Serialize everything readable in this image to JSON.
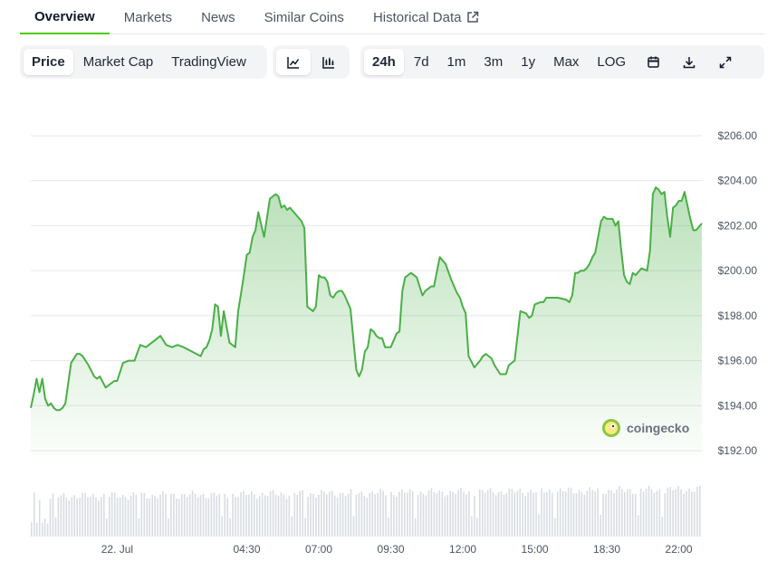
{
  "tabs": [
    {
      "label": "Overview",
      "active": true
    },
    {
      "label": "Markets"
    },
    {
      "label": "News"
    },
    {
      "label": "Similar Coins"
    },
    {
      "label": "Historical Data",
      "external": true
    }
  ],
  "toolbar": {
    "view_buttons": [
      {
        "label": "Price",
        "active": true
      },
      {
        "label": "Market Cap"
      },
      {
        "label": "TradingView"
      }
    ],
    "chart_type_icons": [
      "line-chart-icon",
      "candlestick-chart-icon"
    ],
    "range_buttons": [
      {
        "label": "24h",
        "active": true
      },
      {
        "label": "7d"
      },
      {
        "label": "1m"
      },
      {
        "label": "3m"
      },
      {
        "label": "1y"
      },
      {
        "label": "Max"
      },
      {
        "label": "LOG"
      }
    ],
    "action_icons": [
      "calendar-icon",
      "download-icon",
      "fullscreen-icon"
    ]
  },
  "watermark": {
    "text": "coingecko"
  },
  "colors": {
    "line": "#4aaf47",
    "accent": "#4bcc00",
    "volume": "#d8dce1",
    "grid": "#e5e7eb"
  },
  "chart_data": {
    "type": "area",
    "x_tick_labels": [
      "22. Jul",
      "04:30",
      "07:00",
      "09:30",
      "12:00",
      "15:00",
      "18:30",
      "22:00"
    ],
    "x_tick_hours": [
      0,
      4.5,
      7,
      9.5,
      12,
      14.5,
      17,
      19.5
    ],
    "y_tick_labels": [
      "$206.00",
      "$204.00",
      "$202.00",
      "$200.00",
      "$198.00",
      "$196.00",
      "$194.00",
      "$192.00"
    ],
    "ylim": [
      191.8,
      206.4
    ],
    "grid": true,
    "series": [
      {
        "x_hours": [
          -3.0,
          -2.9,
          -2.8,
          -2.7,
          -2.6,
          -2.5,
          -2.4,
          -2.3,
          -2.2,
          -2.1,
          -2.0,
          -1.9,
          -1.8,
          -1.6,
          -1.4,
          -1.3,
          -1.2,
          -1.0,
          -0.8,
          -0.7,
          -0.6,
          -0.4,
          -0.2,
          -0.1,
          0.0,
          0.2,
          0.4,
          0.6,
          0.8,
          1.0,
          1.1,
          1.3,
          1.5,
          1.7,
          1.9,
          2.1,
          2.3,
          2.6,
          2.9,
          3.0,
          3.1,
          3.2,
          3.3,
          3.4,
          3.5,
          3.6,
          3.7,
          3.9,
          4.1,
          4.2,
          4.3,
          4.4,
          4.5,
          4.6,
          4.7,
          4.8,
          4.9,
          5.1,
          5.3,
          5.5,
          5.6,
          5.7,
          5.8,
          5.9,
          6.0,
          6.2,
          6.4,
          6.5,
          6.6,
          6.8,
          6.9,
          7.0,
          7.1,
          7.2,
          7.3,
          7.4,
          7.5,
          7.6,
          7.7,
          7.8,
          7.9,
          8.1,
          8.3,
          8.4,
          8.5,
          8.6,
          8.7,
          8.8,
          8.9,
          9.0,
          9.1,
          9.2,
          9.3,
          9.5,
          9.7,
          9.8,
          9.9,
          10.0,
          10.1,
          10.2,
          10.4,
          10.6,
          10.7,
          10.8,
          10.9,
          11.0,
          11.2,
          11.4,
          11.6,
          11.8,
          11.9,
          12.0,
          12.1,
          12.2,
          12.4,
          12.6,
          12.7,
          12.8,
          13.0,
          13.1,
          13.3,
          13.5,
          13.6,
          13.8,
          14.0,
          14.2,
          14.3,
          14.4,
          14.5,
          14.7,
          14.8,
          14.9,
          15.1,
          15.3,
          15.6,
          15.7,
          15.8,
          15.9,
          16.0,
          16.1,
          16.2,
          16.3,
          16.4,
          16.5,
          16.6,
          16.8,
          16.9,
          17.0,
          17.2,
          17.3,
          17.4,
          17.5,
          17.6,
          17.7,
          17.8,
          17.9,
          18.0,
          18.2,
          18.4,
          18.5,
          18.6,
          18.7,
          18.8,
          18.9,
          19.0,
          19.1,
          19.2,
          19.3,
          19.4,
          19.5,
          19.6,
          19.7,
          19.8,
          19.9,
          20.0,
          20.1,
          20.3
        ],
        "values": [
          193.9,
          194.5,
          195.2,
          194.6,
          195.2,
          194.3,
          194.0,
          194.1,
          193.9,
          193.8,
          193.8,
          193.9,
          194.1,
          195.9,
          196.3,
          196.3,
          196.2,
          195.8,
          195.3,
          195.2,
          195.3,
          194.8,
          195.0,
          195.1,
          195.1,
          195.9,
          196.0,
          196.0,
          196.7,
          196.6,
          196.7,
          196.9,
          197.1,
          196.7,
          196.6,
          196.7,
          196.6,
          196.4,
          196.2,
          196.5,
          196.6,
          196.9,
          197.4,
          198.5,
          198.4,
          197.1,
          198.2,
          196.8,
          196.6,
          198.2,
          199.0,
          199.8,
          200.7,
          200.8,
          201.5,
          201.8,
          202.6,
          201.5,
          203.2,
          203.4,
          203.3,
          202.8,
          202.9,
          202.7,
          202.8,
          202.5,
          202.2,
          201.9,
          198.4,
          198.2,
          198.4,
          199.8,
          199.7,
          199.7,
          199.5,
          198.9,
          198.8,
          199.0,
          199.1,
          199.1,
          198.9,
          198.3,
          195.6,
          195.3,
          195.6,
          196.4,
          196.6,
          197.4,
          197.3,
          197.1,
          197.0,
          197.0,
          196.6,
          196.6,
          197.2,
          197.3,
          199.1,
          199.7,
          199.8,
          199.9,
          199.7,
          198.9,
          199.1,
          199.2,
          199.3,
          199.3,
          200.6,
          200.3,
          199.6,
          199.0,
          198.8,
          198.4,
          198.1,
          196.2,
          195.7,
          196.0,
          196.2,
          196.3,
          196.1,
          195.8,
          195.4,
          195.4,
          195.8,
          196.0,
          198.2,
          198.1,
          197.9,
          198.0,
          198.5,
          198.6,
          198.6,
          198.8,
          198.8,
          198.8,
          198.7,
          198.6,
          198.9,
          199.9,
          199.9,
          200.0,
          200.0,
          200.1,
          200.3,
          200.6,
          200.8,
          202.2,
          202.4,
          202.3,
          202.3,
          202.0,
          202.2,
          200.9,
          199.8,
          199.5,
          199.4,
          199.9,
          199.8,
          200.1,
          200.0,
          200.9,
          203.4,
          203.7,
          203.6,
          203.4,
          203.5,
          202.4,
          201.5,
          202.8,
          202.9,
          203.1,
          203.1,
          203.5,
          202.9,
          202.3,
          201.8,
          201.8,
          202.1,
          201.9,
          202.0,
          202.1,
          202.0,
          202.2
        ]
      }
    ]
  }
}
